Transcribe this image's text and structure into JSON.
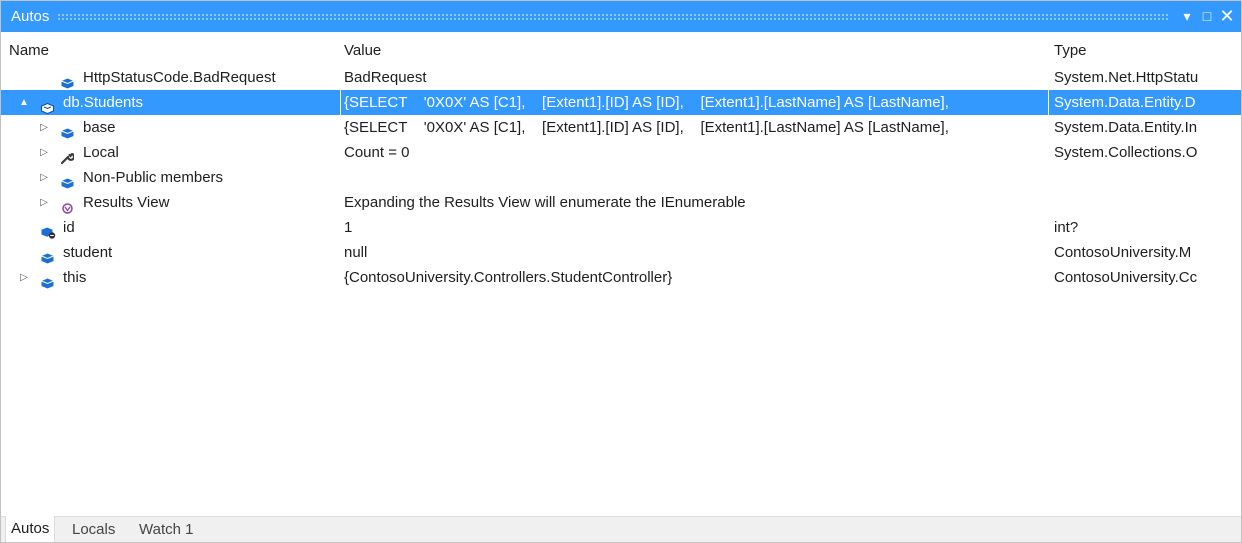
{
  "window": {
    "title": "Autos",
    "dropdown_glyph": "▾",
    "maximize_glyph": "□",
    "close_glyph": "✕"
  },
  "columns": {
    "name": "Name",
    "value": "Value",
    "type": "Type"
  },
  "rows": [
    {
      "name": "HttpStatusCode.BadRequest",
      "value": "BadRequest",
      "type": "System.Net.HttpStatu",
      "icon": "field-icon",
      "indent": 1,
      "expander": ""
    },
    {
      "name": "db.Students",
      "value": "{SELECT    '0X0X' AS [C1],    [Extent1].[ID] AS [ID],    [Extent1].[LastName] AS [LastName],",
      "type": "System.Data.Entity.D",
      "icon": "property-icon",
      "indent": 0,
      "expander": "▲",
      "selected": true
    },
    {
      "name": "base",
      "value": "{SELECT    '0X0X' AS [C1],    [Extent1].[ID] AS [ID],    [Extent1].[LastName] AS [LastName],",
      "type": "System.Data.Entity.In",
      "icon": "field-icon",
      "indent": 1,
      "expander": "▷"
    },
    {
      "name": "Local",
      "value": "Count = 0",
      "type": "System.Collections.O",
      "icon": "wrench-icon",
      "indent": 1,
      "expander": "▷"
    },
    {
      "name": "Non-Public members",
      "value": "",
      "type": "",
      "icon": "field-icon",
      "indent": 1,
      "expander": "▷"
    },
    {
      "name": "Results View",
      "value": "Expanding the Results View will enumerate the IEnumerable",
      "type": "",
      "icon": "results-view-icon",
      "indent": 1,
      "expander": "▷"
    },
    {
      "name": "id",
      "value": "1",
      "type": "int?",
      "icon": "local-variable-icon",
      "indent": 0,
      "expander": ""
    },
    {
      "name": "student",
      "value": "null",
      "type": "ContosoUniversity.M",
      "icon": "field-icon",
      "indent": 0,
      "expander": ""
    },
    {
      "name": "this",
      "value": "{ContosoUniversity.Controllers.StudentController}",
      "type": "ContosoUniversity.Cc",
      "icon": "field-icon",
      "indent": 0,
      "expander": "▷"
    }
  ],
  "tabs": [
    {
      "label": "Autos",
      "active": true
    },
    {
      "label": "Locals",
      "active": false
    },
    {
      "label": "Watch 1",
      "active": false
    }
  ],
  "colors": {
    "accent": "#3399ff",
    "icon_blue": "#1c6fd4",
    "icon_purple": "#8e44ad",
    "icon_dark": "#3a3a3a",
    "selected_text": "#ffffff"
  }
}
